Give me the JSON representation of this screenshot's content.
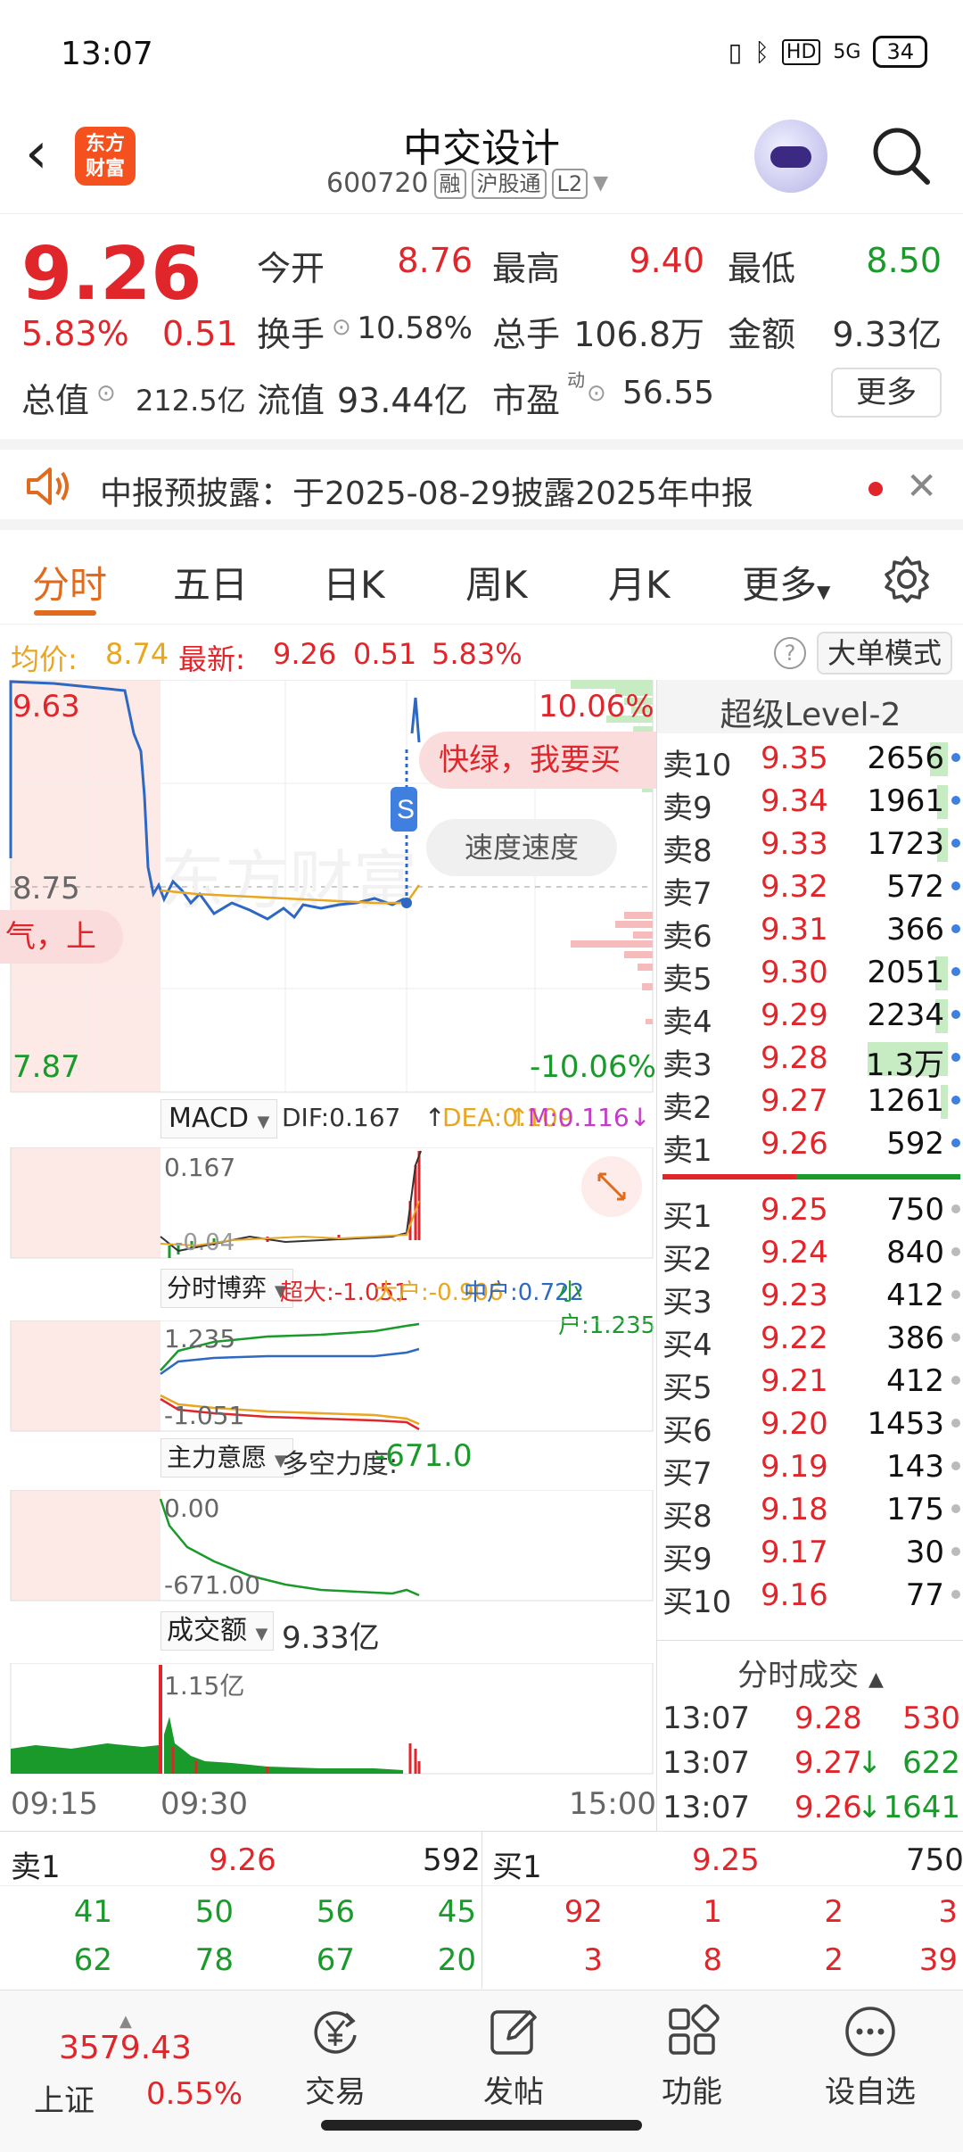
{
  "status_bar": {
    "time": "13:07",
    "network": "5G",
    "hd": "HD",
    "battery": "34"
  },
  "header": {
    "stock_name": "中交设计",
    "stock_code": "600720",
    "tags": [
      "融",
      "沪股通",
      "L2"
    ],
    "logo": "东方\n财富",
    "logo_line1": "东方",
    "logo_line2": "财富"
  },
  "quote": {
    "price": "9.26",
    "pct": "5.83%",
    "change": "0.51",
    "open_label": "今开",
    "open": "8.76",
    "high_label": "最高",
    "high": "9.40",
    "low_label": "最低",
    "low": "8.50",
    "turnover_label": "换手",
    "turnover": "10.58%",
    "volume_label": "总手",
    "volume": "106.8万",
    "amount_label": "金额",
    "amount": "9.33亿",
    "total_cap_label": "总值",
    "total_cap": "212.5亿",
    "float_cap_label": "流值",
    "float_cap": "93.44亿",
    "pe_label": "市盈",
    "pe_sup": "动",
    "pe": "56.55",
    "more_button": "更多"
  },
  "notice": {
    "text": "中报预披露：于2025-08-29披露2025年中报"
  },
  "tabs": [
    "分时",
    "五日",
    "日K",
    "周K",
    "月K",
    "更多"
  ],
  "info_line": {
    "avg_label": "均价:",
    "avg": "8.74",
    "latest_label": "最新:",
    "latest": "9.26",
    "chg": "0.51",
    "pct": "5.83%",
    "mode_button": "大单模式"
  },
  "chart": {
    "y_top": "9.63",
    "y_mid": "8.75",
    "y_bottom": "7.87",
    "pct_top": "10.06%",
    "pct_bottom": "-10.06%",
    "bubble_left": "气，上",
    "bubble_right": "快绿，我要买",
    "speed_button": "速度速度",
    "macd": {
      "label": "MACD",
      "dif": "DIF:0.167",
      "dea": "DEA:0.109",
      "m": "M:0.116",
      "top_value": "0.167",
      "low_value": "-0.04"
    },
    "game": {
      "label": "分时博弈",
      "super": "超大:-1.051",
      "large": "大户:-0.906",
      "mid": "中户:0.722",
      "small": "小户:1.235",
      "top_value": "1.235",
      "low_value": "-1.051"
    },
    "main": {
      "label": "主力意愿",
      "force_label": "多空力度:",
      "force": "-671.0",
      "top_value": "0.00",
      "low_value": "-671.00"
    },
    "amount": {
      "label": "成交额",
      "value": "9.33亿",
      "top_value": "1.15亿"
    },
    "time_axis": [
      "09:15",
      "09:30",
      "15:00"
    ],
    "colors": {
      "price_line": "#2d68c4",
      "avg_line": "#e8a623",
      "up": "#e0262b",
      "down": "#1a9a2a"
    }
  },
  "orderbook": {
    "title": "超级Level-2",
    "asks": [
      {
        "label": "卖10",
        "price": "9.35",
        "vol": "2656",
        "bar": 0.1
      },
      {
        "label": "卖9",
        "price": "9.34",
        "vol": "1961",
        "bar": 0.06
      },
      {
        "label": "卖8",
        "price": "9.33",
        "vol": "1723",
        "bar": 0.06
      },
      {
        "label": "卖7",
        "price": "9.32",
        "vol": "572",
        "bar": 0
      },
      {
        "label": "卖6",
        "price": "9.31",
        "vol": "366",
        "bar": 0
      },
      {
        "label": "卖5",
        "price": "9.30",
        "vol": "2051",
        "bar": 0.07
      },
      {
        "label": "卖4",
        "price": "9.29",
        "vol": "2234",
        "bar": 0.07
      },
      {
        "label": "卖3",
        "price": "9.28",
        "vol": "1.3万",
        "bar": 0.45
      },
      {
        "label": "卖2",
        "price": "9.27",
        "vol": "1261",
        "bar": 0.04
      },
      {
        "label": "卖1",
        "price": "9.26",
        "vol": "592",
        "bar": 0
      }
    ],
    "bids": [
      {
        "label": "买1",
        "price": "9.25",
        "vol": "750"
      },
      {
        "label": "买2",
        "price": "9.24",
        "vol": "840"
      },
      {
        "label": "买3",
        "price": "9.23",
        "vol": "412"
      },
      {
        "label": "买4",
        "price": "9.22",
        "vol": "386"
      },
      {
        "label": "买5",
        "price": "9.21",
        "vol": "412"
      },
      {
        "label": "买6",
        "price": "9.20",
        "vol": "1453"
      },
      {
        "label": "买7",
        "price": "9.19",
        "vol": "143"
      },
      {
        "label": "买8",
        "price": "9.18",
        "vol": "175"
      },
      {
        "label": "买9",
        "price": "9.17",
        "vol": "30"
      },
      {
        "label": "买10",
        "price": "9.16",
        "vol": "77"
      }
    ],
    "trades_title": "分时成交",
    "trades": [
      {
        "time": "13:07",
        "price": "9.28",
        "arrow": "",
        "vol": "530",
        "color": "red"
      },
      {
        "time": "13:07",
        "price": "9.27",
        "arrow": "↓",
        "vol": "622",
        "color": "green"
      },
      {
        "time": "13:07",
        "price": "9.26",
        "arrow": "↓",
        "vol": "1641",
        "color": "green"
      }
    ]
  },
  "bottom_quotes": {
    "ask1_label": "卖1",
    "ask1_price": "9.26",
    "ask1_vol": "592",
    "bid1_label": "买1",
    "bid1_price": "9.25",
    "bid1_vol": "750",
    "ask_row1": [
      "41",
      "50",
      "56",
      "45"
    ],
    "ask_row2": [
      "62",
      "78",
      "67",
      "20"
    ],
    "bid_row1": [
      "92",
      "1",
      "2",
      "3"
    ],
    "bid_row2": [
      "3",
      "8",
      "2",
      "39"
    ]
  },
  "bottom_nav": {
    "index_value": "3579.43",
    "index_name": "上证",
    "index_pct": "0.55%",
    "items": [
      "交易",
      "发帖",
      "功能",
      "设自选"
    ]
  }
}
